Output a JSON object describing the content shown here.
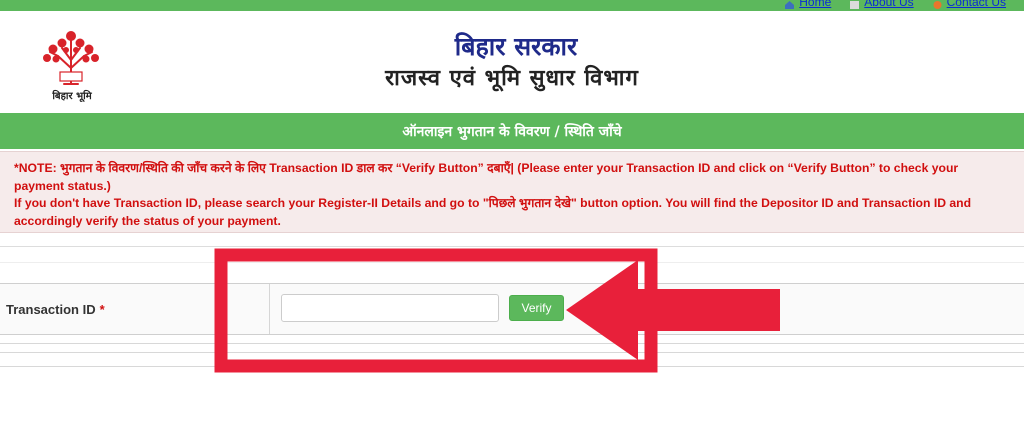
{
  "topnav": {
    "home_label": "Home",
    "about_label": "About Us",
    "contact_label": "Contact Us"
  },
  "header": {
    "logo_caption": "बिहार भूमि",
    "gov_title": "बिहार सरकार",
    "dept_title": "राजस्व एवं भूमि सुधार विभाग"
  },
  "banner": {
    "title": "ऑनलाइन भुगतान के विवरण / स्थिति जाँचे"
  },
  "note": {
    "line1": "*NOTE: भुगतान के विवरण/स्थिति की जाँच करने के लिए Transaction ID डाल कर “Verify Button” दबाएँ| (Please enter your Transaction ID and click on “Verify Button” to check your payment status.)",
    "line2": "If you don't have Transaction ID, please search your Register-II Details and go to \"पिछले भुगतान देखे\" button option. You will find the Depositor ID and Transaction ID and accordingly verify the status of your payment."
  },
  "form": {
    "transaction_label": "Transaction ID",
    "required_mark": "*",
    "transaction_value": "",
    "transaction_placeholder": "",
    "verify_label": "Verify"
  },
  "colors": {
    "green": "#5cb85c",
    "note_red": "#d10f0f",
    "annotation_red": "#e8203a",
    "title_blue": "#1f2a8a"
  }
}
